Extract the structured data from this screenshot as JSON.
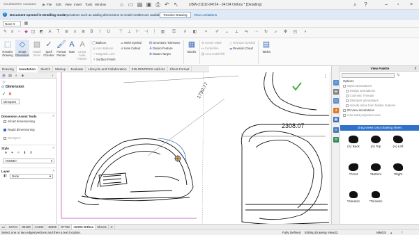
{
  "titlebar": {
    "logo": "SOLIDWORKS",
    "logo_sub": "Connected",
    "menus": [
      "File",
      "Edit",
      "View",
      "Insert",
      "Tools",
      "Window"
    ],
    "doc_title": "UBW-21102-04724 - 04724 Orthos * [Detailing]"
  },
  "notification": {
    "bold_text": "Document opened in Detailing mode",
    "text": "Operations such as adding dimensions to model entities are available.",
    "resolve_button": "Resolve Drawing",
    "view_limitations": "View Limitations"
  },
  "toolbar": {
    "dropdown_value": "None"
  },
  "ribbon": {
    "big_buttons": [
      {
        "label": "Resolve Drawing",
        "icon": "resolve-icon"
      },
      {
        "label": "Smart Dimension",
        "icon": "smart-dimension-icon"
      },
      {
        "label": "Model Items",
        "icon": "model-items-icon"
      },
      {
        "label": "Spell Checker",
        "icon": "spell-checker-icon"
      },
      {
        "label": "Format Painter",
        "icon": "format-painter-icon"
      },
      {
        "label": "Note",
        "icon": "note-icon"
      },
      {
        "label": "Linear Note Pattern",
        "icon": "note-pattern-icon"
      }
    ],
    "group1": [
      "Balloon",
      "Auto Balloon",
      "Magnetic Line",
      "Surface Finish"
    ],
    "group2": [
      "Weld Symbol",
      "Hole Callout"
    ],
    "group3": [
      "Geometric Tolerance",
      "Datum Feature",
      "Datum Target"
    ],
    "blocks": "Blocks",
    "group4": [
      "Center Mark",
      "Centerline",
      "Area Hatch/Fill"
    ],
    "group5": [
      "Revision Symbol",
      "Revision Cloud"
    ],
    "tables": "Tables"
  },
  "tabs": [
    "Drawing",
    "Annotation",
    "Sketch",
    "Markup",
    "Evaluate",
    "Lifecycle and Collaboration",
    "SOLIDWORKS Add-Ins",
    "Sheet Format"
  ],
  "active_tab": "Annotation",
  "left_panel": {
    "title": "Dimension",
    "ok": "✓",
    "cancel": "✕",
    "input_value": "Dimxpert",
    "sections": {
      "smart_tools": "Dimension Assist Tools",
      "style": "Style",
      "layer": "Layer"
    },
    "options": [
      "Smart dimensioning",
      "Rapid dimensioning",
      "DimXpert"
    ],
    "style_value": "<NONE>",
    "layer_value": "None"
  },
  "drawing": {
    "dim_angle": "1790.77",
    "dim_horizontal": "2308.07"
  },
  "view_palette": {
    "title": "View Palette",
    "options_header": "Options",
    "options": [
      "Import annotations",
      "Design annotations",
      "Cosmetic Threads",
      "DimXpert annotations",
      "Include items from hidden features",
      "3D View annotations",
      "Auto-start projection view"
    ],
    "drag_hint": "Drag views onto drawing sheet.",
    "views": [
      "(A) Back",
      "(A) Top",
      "(A) Left",
      "*Front",
      "*Bottom",
      "*Right",
      "*Dimetric",
      "*Trimetric"
    ]
  },
  "sheet_tabs": [
    "04724",
    "08188",
    "44182",
    "45599",
    "07769",
    "04724 Orthos",
    "Sheet1"
  ],
  "active_sheet": "04724 Orthos",
  "status": {
    "message": "Select one or two edges/vertices and then a text location.",
    "defined": "Fully Defined",
    "editing": "Editing Drawing View22",
    "units": "MMGS"
  },
  "colors": {
    "accent": "#2f72c9",
    "brand": "#c8102e",
    "dim_text": "#444444"
  }
}
